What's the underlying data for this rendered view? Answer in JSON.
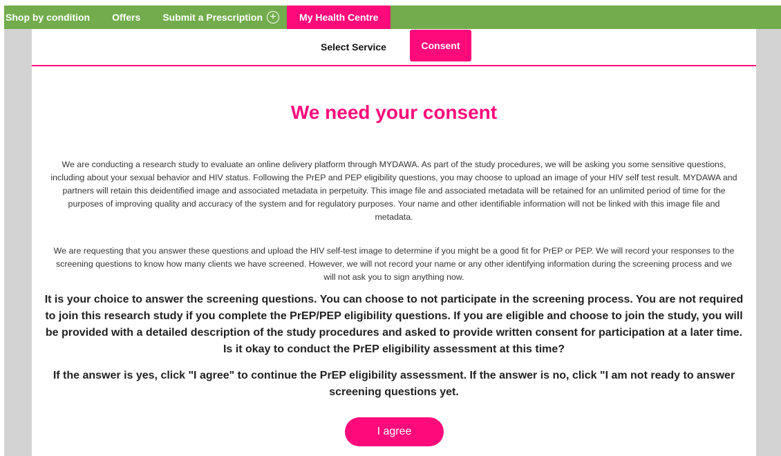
{
  "nav": {
    "items": [
      {
        "label": "Shop by condition"
      },
      {
        "label": "Offers"
      },
      {
        "label": "Submit a Prescription"
      },
      {
        "label": "My Health Centre",
        "active": true
      }
    ],
    "prescription_icon": "plus-circle-icon",
    "accent_color": "#72ac4c",
    "active_color": "#ff0a7b"
  },
  "steps": {
    "select_service": "Select Service",
    "consent": "Consent",
    "current": "Consent"
  },
  "consent": {
    "title": "We need your consent",
    "paragraph1": "We are conducting a research study to evaluate an online delivery platform through MYDAWA. As part of the study procedures, we will be asking you some sensitive questions, including about your sexual behavior and HIV status. Following the PrEP and PEP eligibility questions, you may choose to upload an image of your HIV self test result. MYDAWA and partners will retain this deidentified image and associated metadata in perpetuity. This image file and associated metadata will be retained for an unlimited period of time for the purposes of improving quality and accuracy of the system and for regulatory purposes. Your name and other identifiable information will not be linked with this image file and metadata.",
    "paragraph2": "We are requesting that you answer these questions and upload the HIV self-test image to determine if you might be a good fit for PrEP or PEP. We will record your responses to the screening questions to know how many clients we have screened. However, we will not record your name or any other identifying information during the screening process and we will not ask you to sign anything now.",
    "bold_paragraph1": "It is your choice to answer the screening questions. You can choose to not participate in the screening process. You are not required to join this research study if you complete the PrEP/PEP eligibility questions. If you are eligible and choose to join the study, you will be provided with a detailed description of the study procedures and asked to provide written consent for participation at a later time. Is it okay to conduct the PrEP eligibility assessment at this time?",
    "bold_paragraph2": "If the answer is yes, click \"I agree\" to continue the PrEP eligibility assessment. If the answer is no, click \"I am not ready to answer screening questions yet.",
    "agree_button": "I agree"
  }
}
